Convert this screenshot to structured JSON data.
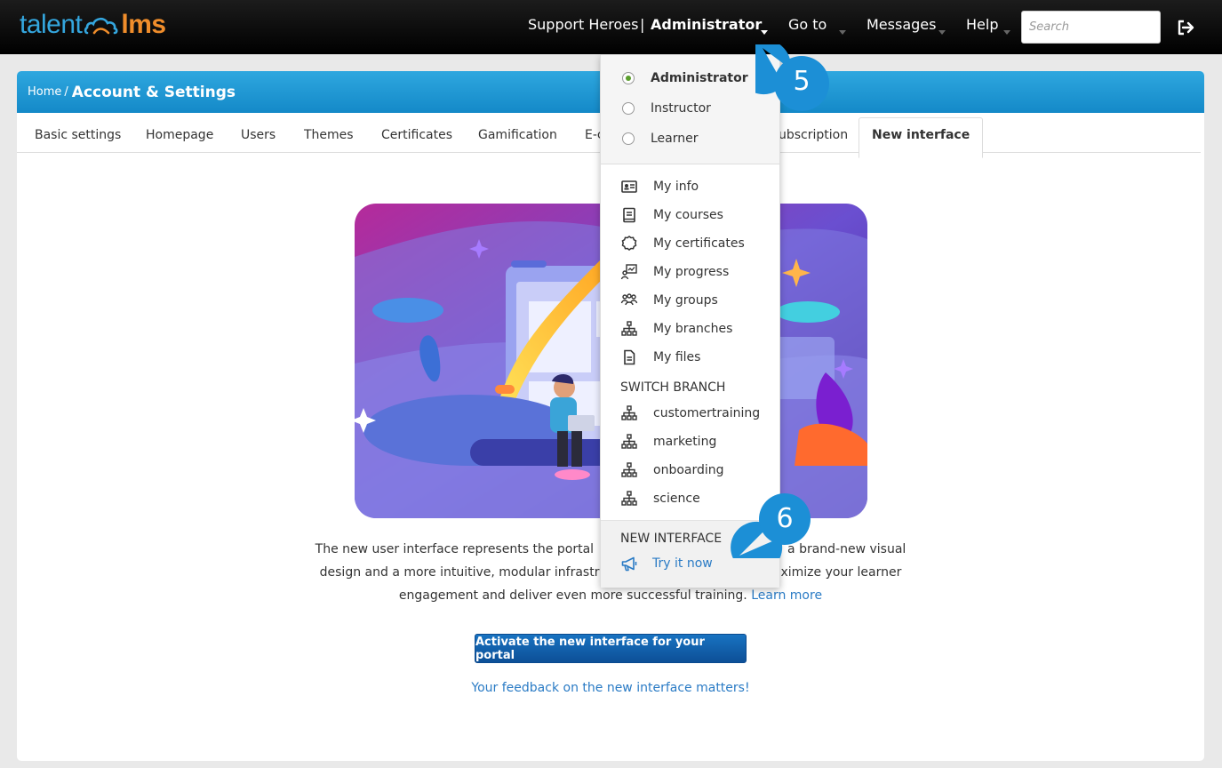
{
  "brand": {
    "part1": "talent",
    "part2": "lms"
  },
  "topnav": {
    "portal": "Support Heroes",
    "separator": "|",
    "role": "Administrator",
    "goto": "Go to",
    "messages": "Messages",
    "help": "Help",
    "search_placeholder": "Search"
  },
  "breadcrumb": {
    "home": "Home",
    "sep": "/",
    "current": "Account & Settings"
  },
  "tabs": [
    "Basic settings",
    "Homepage",
    "Users",
    "Themes",
    "Certificates",
    "Gamification",
    "E-c",
    "ubscription",
    "New interface"
  ],
  "active_tab": "New interface",
  "description": {
    "line1a": "The new user interface represents the portal",
    "line1b": "a brand-new visual",
    "line2a": "design and a more intuitive, modular infrastr",
    "line2b": "ximize your learner",
    "line3": "engagement and deliver even more successful training.",
    "learn_more": "Learn more"
  },
  "cta_label": "Activate the new interface for your portal",
  "feedback_link": "Your feedback on the new interface matters!",
  "dropdown": {
    "roles": [
      "Administrator",
      "Instructor",
      "Learner"
    ],
    "selected_role": "Administrator",
    "items": [
      "My info",
      "My courses",
      "My certificates",
      "My progress",
      "My groups",
      "My branches",
      "My files"
    ],
    "switch_branch_heading": "SWITCH BRANCH",
    "branches": [
      "customertraining",
      "marketing",
      "onboarding",
      "science"
    ],
    "new_interface_heading": "NEW INTERFACE",
    "try_it_now": "Try it now"
  },
  "callouts": [
    "5",
    "6"
  ],
  "colors": {
    "topbar": "#000000",
    "panel_header": "#1e96d4",
    "brand_blue": "#34a6de",
    "brand_orange": "#f08d2b",
    "link": "#2a7bc5",
    "cta": "#125fad",
    "callout": "#1c8fd6"
  },
  "icons": [
    "cloud-logo-icon",
    "caret-down-icon",
    "logout-icon",
    "id-card-icon",
    "book-icon",
    "certificate-icon",
    "progress-icon",
    "groups-icon",
    "branch-icon",
    "file-icon",
    "megaphone-icon"
  ]
}
